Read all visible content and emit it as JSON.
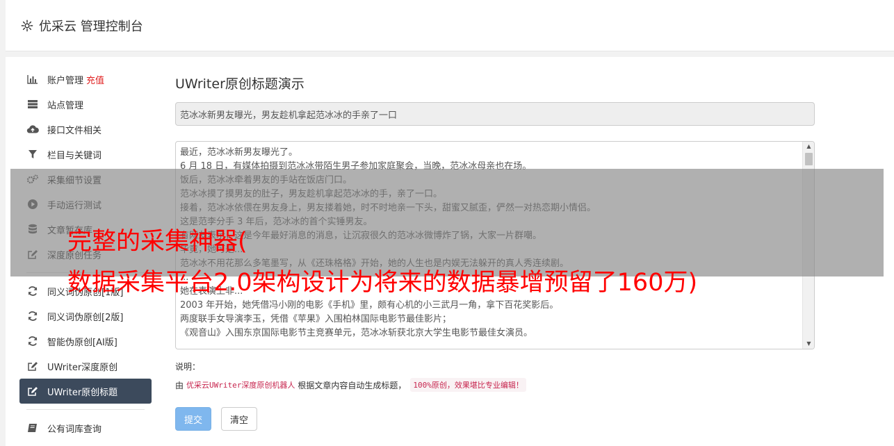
{
  "app": {
    "title": "优采云 管理控制台"
  },
  "sidebar": {
    "groups": [
      [
        {
          "label": "账户管理",
          "badge": "充值",
          "icon": "bar-chart-icon"
        },
        {
          "label": "站点管理",
          "icon": "server-icon"
        },
        {
          "label": "接口文件相关",
          "icon": "cloud-upload-icon"
        },
        {
          "label": "栏目与关键词",
          "icon": "filter-icon"
        },
        {
          "label": "采集细节设置",
          "icon": "gears-icon"
        },
        {
          "label": "手动运行测试",
          "icon": "play-circle-icon"
        },
        {
          "label": "文章暂存库",
          "icon": "database-icon"
        },
        {
          "label": "深度原创任务",
          "icon": "edit-icon"
        }
      ],
      [
        {
          "label": "同义词伪原创[1版]",
          "icon": "refresh-icon"
        },
        {
          "label": "同义词伪原创[2版]",
          "icon": "refresh-icon"
        },
        {
          "label": "智能伪原创[AI版]",
          "icon": "refresh-icon"
        },
        {
          "label": "UWriter深度原创",
          "icon": "edit-icon"
        },
        {
          "label": "UWriter原创标题",
          "icon": "edit-icon",
          "active": true
        }
      ],
      [
        {
          "label": "公有词库查询",
          "icon": "book-icon"
        }
      ]
    ]
  },
  "main": {
    "heading": "UWriter原创标题演示",
    "title_value": "范冰冰新男友曝光，男友趁机拿起范冰冰的手亲了一口",
    "content_lines": [
      "最近，范冰冰新男友曝光了。",
      "6 月 18 日，有媒体拍摄到范冰冰带陌生男子参加家庭聚会，当晚，范冰冰母亲也在场。",
      "饭后，范冰冰牵着男友的手站在饭店门口。",
      "范冰冰摸了摸男友的肚子，男友趁机拿起范冰冰的手，亲了一口。",
      "接着，范冰冰依偎在男友身上，男友搂着她，时不时地亲一下头，甜蜜又腻歪，俨然一对热恋期小情侣。",
      "这是范李分手 3 年后，范冰冰的首个实锤男友。",
      "有网友表示，这是今年最好消息的消息，让沉寂很久的范冰冰微博炸了锅，大家一片群嘲。",
      "毕竟，她可是...",
      "范冰冰不用花那么多笔墨写，从《还珠格格》开始，她的人生也是内娱无法躲开的真人秀连续剧。",
      "...",
      "她在表演上非...",
      "2003 年开始，她凭借冯小刚的电影《手机》里，颇有心机的小三武月一角，拿下百花奖影后。",
      "两度联手女导演李玉，凭借《苹果》入围柏林国际电影节最佳影片；",
      "《观音山》入围东京国际电影节主竞赛单元，范冰冰斩获北京大学生电影节最佳女演员。"
    ],
    "note_label": "说明：",
    "note_prefix": "由",
    "note_code": "优采云UWriter深度原创机器人",
    "note_middle": "根据文章内容自动生成标题，",
    "note_badge": "100%原创，效果堪比专业编辑！",
    "submit_label": "提交",
    "clear_label": "清空"
  },
  "watermark": {
    "line1": "完整的采集神器(",
    "line2": "数据采集平台2.0架构设计为将来的数据暴增预留了160万)"
  },
  "colors": {
    "active_bg": "#3c4a5c",
    "badge": "#e02020",
    "watermark": "#ff0000",
    "primary": "#7fb7ee"
  }
}
